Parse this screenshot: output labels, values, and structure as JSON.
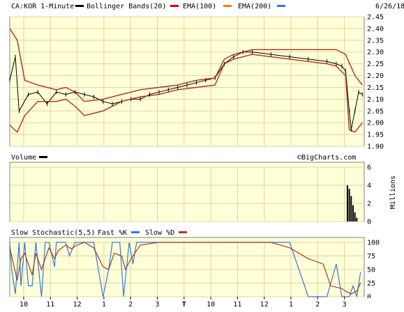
{
  "header": {
    "symbol": "CA:KOR 1-Minute",
    "date": "6/26/18",
    "legend": [
      {
        "label": "Bollinger Bands(20)",
        "color": "#000000"
      },
      {
        "label": "EMA(100)",
        "color": "#cc0000"
      },
      {
        "label": "EMA(200)",
        "color": "#f08000"
      },
      {
        "label": "",
        "color": "#3377dd"
      }
    ]
  },
  "volume_panel": {
    "label": "Volume",
    "watermark": "©BigCharts.com",
    "units": "Millions"
  },
  "stochastic_panel": {
    "label": "Slow Stochastic(5,5)",
    "fast_label": "Fast %K",
    "slow_label": "Slow %D"
  },
  "colors": {
    "background": "#ffffd8",
    "grid": "#d8d8a0",
    "bollinger": "#000000",
    "ema100": "#cc0000",
    "ema200": "#f08000",
    "band_line": "#b03020",
    "fast_k": "#3377dd",
    "slow_d": "#a04020"
  },
  "chart_data": [
    {
      "type": "line",
      "title": "CA:KOR 1-Minute",
      "x_ticks": [
        "10",
        "11",
        "12",
        "1",
        "2",
        "3",
        "T",
        "10",
        "11",
        "12",
        "1",
        "2",
        "3"
      ],
      "ylim": [
        1.9,
        2.45
      ],
      "y_ticks": [
        "2.45",
        "2.40",
        "2.35",
        "2.30",
        "2.25",
        "2.20",
        "2.15",
        "2.10",
        "2.05",
        "2.00",
        "1.95",
        "1.90"
      ],
      "grid": true,
      "series": [
        {
          "name": "",
          "values": [
            [
              0.0,
              2.18
            ],
            [
              0.3,
              2.28
            ],
            [
              0.5,
              2.05
            ],
            [
              1.0,
              2.12
            ],
            [
              1.5,
              2.13
            ],
            [
              2.0,
              2.08
            ],
            [
              2.5,
              2.13
            ],
            [
              3.0,
              2.12
            ],
            [
              3.5,
              2.13
            ],
            [
              4.0,
              2.12
            ],
            [
              4.5,
              2.11
            ],
            [
              5.0,
              2.09
            ],
            [
              5.5,
              2.08
            ],
            [
              6.0,
              2.09
            ],
            [
              6.5,
              2.1
            ],
            [
              7.0,
              2.1
            ],
            [
              7.5,
              2.12
            ],
            [
              8.0,
              2.13
            ],
            [
              8.5,
              2.14
            ],
            [
              9.0,
              2.15
            ],
            [
              9.5,
              2.16
            ],
            [
              10.0,
              2.17
            ],
            [
              10.5,
              2.18
            ],
            [
              11.0,
              2.19
            ],
            [
              11.5,
              2.25
            ],
            [
              12.0,
              2.28
            ],
            [
              12.5,
              2.3
            ],
            [
              13.0,
              2.3
            ],
            [
              14.0,
              2.29
            ],
            [
              15.0,
              2.28
            ],
            [
              16.0,
              2.27
            ],
            [
              17.0,
              2.26
            ],
            [
              17.5,
              2.25
            ],
            [
              17.8,
              2.24
            ],
            [
              18.0,
              2.22
            ],
            [
              18.2,
              2.05
            ],
            [
              18.3,
              1.97
            ],
            [
              18.5,
              2.05
            ],
            [
              18.7,
              2.13
            ],
            [
              18.9,
              2.12
            ]
          ]
        },
        {
          "name": "",
          "values": [
            [
              0.0,
              2.4
            ],
            [
              0.4,
              2.35
            ],
            [
              0.8,
              2.18
            ],
            [
              1.5,
              2.16
            ],
            [
              2.5,
              2.14
            ],
            [
              3.0,
              2.15
            ],
            [
              3.5,
              2.13
            ],
            [
              4.0,
              2.09
            ],
            [
              5.0,
              2.1
            ],
            [
              6.0,
              2.12
            ],
            [
              7.0,
              2.14
            ],
            [
              8.0,
              2.15
            ],
            [
              9.0,
              2.16
            ],
            [
              10.0,
              2.18
            ],
            [
              11.0,
              2.19
            ],
            [
              11.5,
              2.27
            ],
            [
              12.0,
              2.29
            ],
            [
              13.0,
              2.31
            ],
            [
              14.0,
              2.31
            ],
            [
              15.0,
              2.31
            ],
            [
              16.0,
              2.31
            ],
            [
              17.0,
              2.31
            ],
            [
              17.5,
              2.31
            ],
            [
              18.0,
              2.29
            ],
            [
              18.5,
              2.2
            ],
            [
              18.9,
              2.16
            ]
          ]
        },
        {
          "name": "",
          "values": [
            [
              0.0,
              1.99
            ],
            [
              0.4,
              1.96
            ],
            [
              0.8,
              2.03
            ],
            [
              1.5,
              2.09
            ],
            [
              2.5,
              2.09
            ],
            [
              3.0,
              2.1
            ],
            [
              3.5,
              2.07
            ],
            [
              4.0,
              2.03
            ],
            [
              5.0,
              2.05
            ],
            [
              6.0,
              2.09
            ],
            [
              7.0,
              2.11
            ],
            [
              8.0,
              2.12
            ],
            [
              9.0,
              2.14
            ],
            [
              10.0,
              2.15
            ],
            [
              11.0,
              2.16
            ],
            [
              11.5,
              2.25
            ],
            [
              12.0,
              2.27
            ],
            [
              13.0,
              2.29
            ],
            [
              14.0,
              2.28
            ],
            [
              15.0,
              2.27
            ],
            [
              16.0,
              2.26
            ],
            [
              17.0,
              2.25
            ],
            [
              17.5,
              2.24
            ],
            [
              18.0,
              2.2
            ],
            [
              18.2,
              1.97
            ],
            [
              18.5,
              1.96
            ],
            [
              18.9,
              2.0
            ]
          ]
        }
      ]
    },
    {
      "type": "bar",
      "title": "Volume",
      "ylabel": "Millions",
      "ylim": [
        0,
        6
      ],
      "y_ticks": [
        "6",
        "4",
        "2",
        "0"
      ],
      "grid": true,
      "x": [
        18.1,
        18.2,
        18.3,
        18.4,
        18.5,
        18.6
      ],
      "values": [
        4.0,
        3.6,
        2.8,
        1.8,
        1.0,
        0.4
      ]
    },
    {
      "type": "line",
      "title": "Slow Stochastic(5,5)",
      "ylim": [
        0,
        100
      ],
      "y_ticks": [
        "100",
        "75",
        "50",
        "25",
        "0"
      ],
      "grid": true,
      "series": [
        {
          "name": "Fast %K",
          "values": [
            [
              0.0,
              100
            ],
            [
              0.1,
              50
            ],
            [
              0.3,
              5
            ],
            [
              0.5,
              100
            ],
            [
              0.6,
              20
            ],
            [
              0.8,
              100
            ],
            [
              1.0,
              20
            ],
            [
              1.2,
              20
            ],
            [
              1.4,
              100
            ],
            [
              1.7,
              0
            ],
            [
              1.9,
              100
            ],
            [
              2.1,
              100
            ],
            [
              2.4,
              55
            ],
            [
              2.5,
              100
            ],
            [
              3.0,
              100
            ],
            [
              3.2,
              75
            ],
            [
              3.5,
              100
            ],
            [
              4.0,
              100
            ],
            [
              4.5,
              100
            ],
            [
              5.0,
              0
            ],
            [
              5.3,
              50
            ],
            [
              5.5,
              100
            ],
            [
              5.9,
              100
            ],
            [
              6.1,
              0
            ],
            [
              6.4,
              100
            ],
            [
              6.6,
              60
            ],
            [
              6.8,
              100
            ],
            [
              7.0,
              100
            ],
            [
              7.5,
              100
            ],
            [
              8.0,
              100
            ],
            [
              8.5,
              100
            ],
            [
              9.0,
              100
            ],
            [
              9.5,
              100
            ],
            [
              10.0,
              100
            ],
            [
              11.0,
              100
            ],
            [
              12.0,
              100
            ],
            [
              13.0,
              100
            ],
            [
              14.0,
              100
            ],
            [
              15.0,
              100
            ],
            [
              16.0,
              0
            ],
            [
              17.0,
              0
            ],
            [
              17.5,
              60
            ],
            [
              17.8,
              0
            ],
            [
              18.0,
              0
            ],
            [
              18.2,
              0
            ],
            [
              18.4,
              20
            ],
            [
              18.6,
              0
            ],
            [
              18.8,
              45
            ]
          ]
        },
        {
          "name": "Slow %D",
          "values": [
            [
              0.0,
              90
            ],
            [
              0.2,
              60
            ],
            [
              0.4,
              30
            ],
            [
              0.6,
              70
            ],
            [
              0.8,
              80
            ],
            [
              1.0,
              60
            ],
            [
              1.2,
              40
            ],
            [
              1.4,
              80
            ],
            [
              1.7,
              50
            ],
            [
              1.9,
              70
            ],
            [
              2.1,
              90
            ],
            [
              2.4,
              70
            ],
            [
              2.6,
              85
            ],
            [
              3.0,
              95
            ],
            [
              3.3,
              88
            ],
            [
              3.6,
              95
            ],
            [
              4.0,
              100
            ],
            [
              4.5,
              90
            ],
            [
              5.0,
              55
            ],
            [
              5.3,
              50
            ],
            [
              5.6,
              80
            ],
            [
              6.0,
              75
            ],
            [
              6.2,
              50
            ],
            [
              6.5,
              70
            ],
            [
              6.8,
              85
            ],
            [
              7.0,
              95
            ],
            [
              8.0,
              100
            ],
            [
              9.0,
              100
            ],
            [
              10.0,
              100
            ],
            [
              11.0,
              100
            ],
            [
              12.0,
              100
            ],
            [
              13.0,
              100
            ],
            [
              14.0,
              100
            ],
            [
              15.0,
              90
            ],
            [
              16.0,
              70
            ],
            [
              16.8,
              60
            ],
            [
              17.2,
              20
            ],
            [
              17.8,
              15
            ],
            [
              18.0,
              10
            ],
            [
              18.3,
              5
            ],
            [
              18.6,
              10
            ],
            [
              18.8,
              25
            ]
          ]
        }
      ]
    }
  ]
}
